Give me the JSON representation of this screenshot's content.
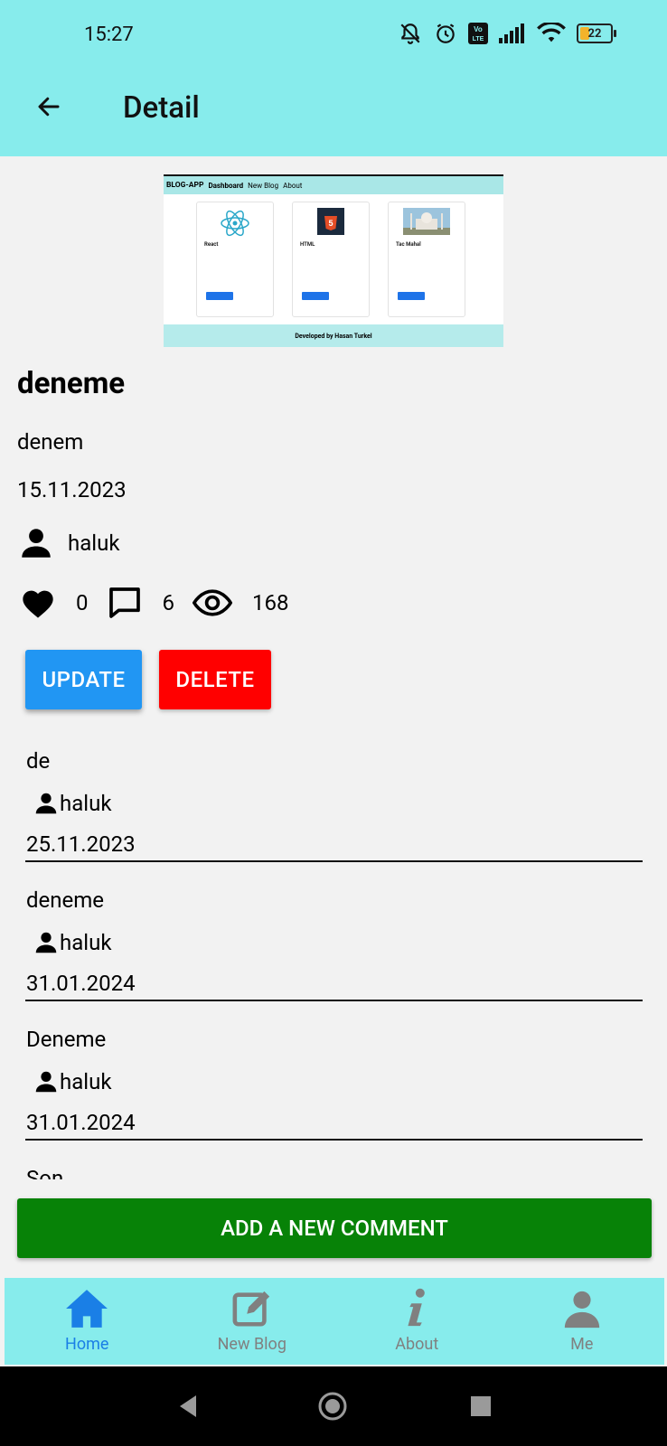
{
  "status_bar": {
    "time": "15:27",
    "battery": "22"
  },
  "header": {
    "title": "Detail"
  },
  "thumbnail": {
    "brand": "BLOG-APP",
    "nav": [
      "Dashboard",
      "New Blog",
      "About"
    ],
    "cards": [
      {
        "title": "React"
      },
      {
        "title": "HTML"
      },
      {
        "title": "Tac Mahal"
      }
    ],
    "footer": "Developed by Hasan Turkel"
  },
  "post": {
    "title": "deneme",
    "content": "denem",
    "date": "15.11.2023",
    "author": "haluk",
    "likes": "0",
    "comments": "6",
    "views": "168"
  },
  "actions": {
    "update": "UPDATE",
    "delete": "DELETE"
  },
  "comments": [
    {
      "text": "de",
      "user": "haluk",
      "date": "25.11.2023"
    },
    {
      "text": "deneme",
      "user": "haluk",
      "date": "31.01.2024"
    },
    {
      "text": "Deneme",
      "user": "haluk",
      "date": "31.01.2024"
    },
    {
      "text": "Son",
      "user": "",
      "date": ""
    }
  ],
  "add_comment": "ADD A NEW COMMENT",
  "bottom_nav": [
    {
      "label": "Home",
      "icon": "home-icon",
      "active": true
    },
    {
      "label": "New Blog",
      "icon": "edit-icon",
      "active": false
    },
    {
      "label": "About",
      "icon": "info-icon",
      "active": false
    },
    {
      "label": "Me",
      "icon": "person-icon",
      "active": false
    }
  ],
  "colors": {
    "appbar": "#87ecec",
    "update": "#2196f3",
    "delete": "#ff0000",
    "add": "#078207",
    "active_nav": "#1a7fe6"
  }
}
